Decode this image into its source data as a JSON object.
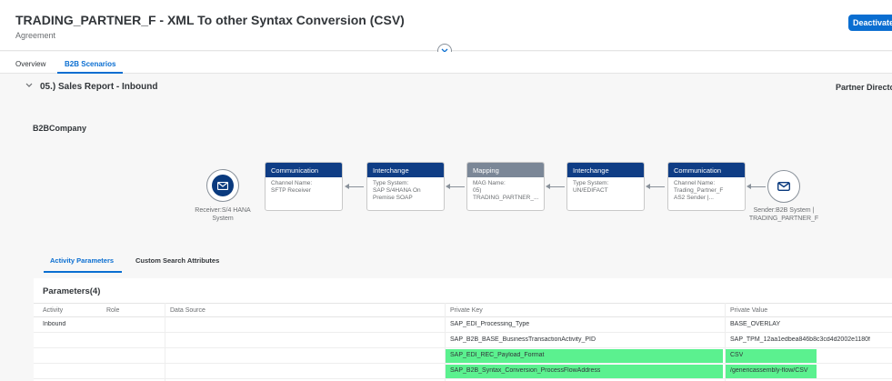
{
  "header": {
    "title": "TRADING_PARTNER_F - XML To other Syntax Conversion (CSV)",
    "subtitle": "Agreement",
    "deactivate_label": "Deactivate"
  },
  "tabs": [
    {
      "label": "Overview",
      "active": false
    },
    {
      "label": "B2B Scenarios",
      "active": true
    }
  ],
  "section": {
    "title": "05.) Sales Report - Inbound",
    "right_label": "Partner Directo"
  },
  "company": "B2BCompany",
  "flow": {
    "receiver": {
      "caption_line1": "Receiver:S/4 HANA",
      "caption_line2": "System",
      "icon": "envelope-icon"
    },
    "sender": {
      "caption_line1": "Sender:B2B System |",
      "caption_line2": "TRADING_PARTNER_F",
      "icon": "envelope-icon"
    },
    "cards": [
      {
        "title": "Communication",
        "line1": "Channel Name:",
        "line2": "SFTP Receiver",
        "line3": ""
      },
      {
        "title": "Interchange",
        "line1": "Type System:",
        "line2": "SAP S/4HANA On",
        "line3": "Premise SOAP"
      },
      {
        "title": "Mapping",
        "line1": "MAG Name:",
        "line2": "05)",
        "line3": "TRADING_PARTNER_..."
      },
      {
        "title": "Interchange",
        "line1": "Type System:",
        "line2": "UN/EDIFACT",
        "line3": ""
      },
      {
        "title": "Communication",
        "line1": "Channel Name:",
        "line2": "Trading_Partner_F",
        "line3": "AS2 Sender |..."
      }
    ],
    "colors": {
      "card_header": "#0f3d85",
      "mapping_header": "#7b8797",
      "highlight": "#5bf18f"
    }
  },
  "subtabs": [
    {
      "label": "Activity Parameters",
      "active": true
    },
    {
      "label": "Custom Search Attributes",
      "active": false
    }
  ],
  "parameters": {
    "title": "Parameters(4)",
    "columns": [
      "Activity",
      "Role",
      "Data Source",
      "Private Key",
      "Private Value"
    ],
    "rows": [
      {
        "activity": "Inbound",
        "role": "",
        "source": "",
        "key": "SAP_EDI_Processing_Type",
        "value": "BASE_OVERLAY",
        "highlight": false
      },
      {
        "activity": "",
        "role": "",
        "source": "",
        "key": "SAP_B2B_BASE_BusinessTransactionActivity_PID",
        "value": "SAP_TPM_12aa1edbea846b8c3cd4d2002e1180f",
        "highlight": false
      },
      {
        "activity": "",
        "role": "",
        "source": "",
        "key": "SAP_EDI_REC_Payload_Format",
        "value": "CSV",
        "highlight": true
      },
      {
        "activity": "",
        "role": "",
        "source": "",
        "key": "SAP_B2B_Syntax_Conversion_ProcessFlowAddress",
        "value": "/genericassembly-flow/CSV",
        "highlight": true
      }
    ]
  }
}
